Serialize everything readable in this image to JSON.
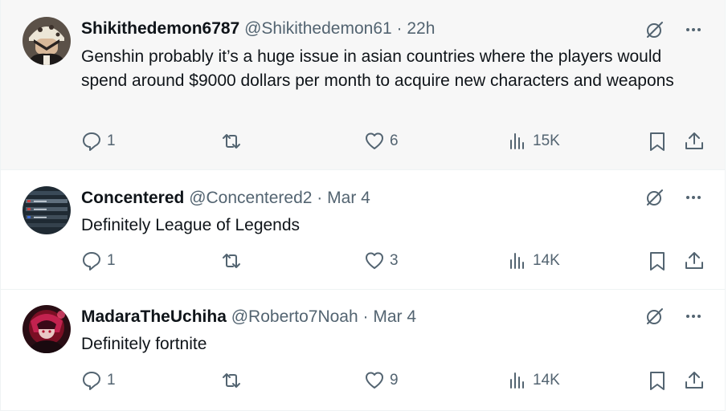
{
  "tweets": [
    {
      "name": "Shikithedemon6787",
      "handle": "@Shikithedemon61",
      "time": "22h",
      "text": "Genshin probably it’s a huge issue in asian countries where the players would spend around $9000 dollars per month to acquire new characters and weapons",
      "replies": "1",
      "retweets": "",
      "likes": "6",
      "views": "15K",
      "avatar": "anime-character-avatar"
    },
    {
      "name": "Concentered",
      "handle": "@Concentered2",
      "time": "Mar 4",
      "text": "Definitely League of Legends",
      "replies": "1",
      "retweets": "",
      "likes": "3",
      "views": "14K",
      "avatar": "leaderboard-screenshot-avatar"
    },
    {
      "name": "MadaraTheUchiha",
      "handle": "@Roberto7Noah",
      "time": "Mar 4",
      "text": "Definitely fortnite",
      "replies": "1",
      "retweets": "",
      "likes": "9",
      "views": "14K",
      "avatar": "red-anime-avatar"
    }
  ],
  "separator": "·",
  "icons": {
    "grok": "grok-icon",
    "more": "more-icon",
    "reply": "reply-icon",
    "retweet": "retweet-icon",
    "like": "heart-icon",
    "views": "views-icon",
    "bookmark": "bookmark-icon",
    "share": "share-icon"
  },
  "colors": {
    "text": "#0f1419",
    "secondary": "#536471",
    "highlight_bg": "#f7f7f7",
    "border": "#eff3f4"
  }
}
